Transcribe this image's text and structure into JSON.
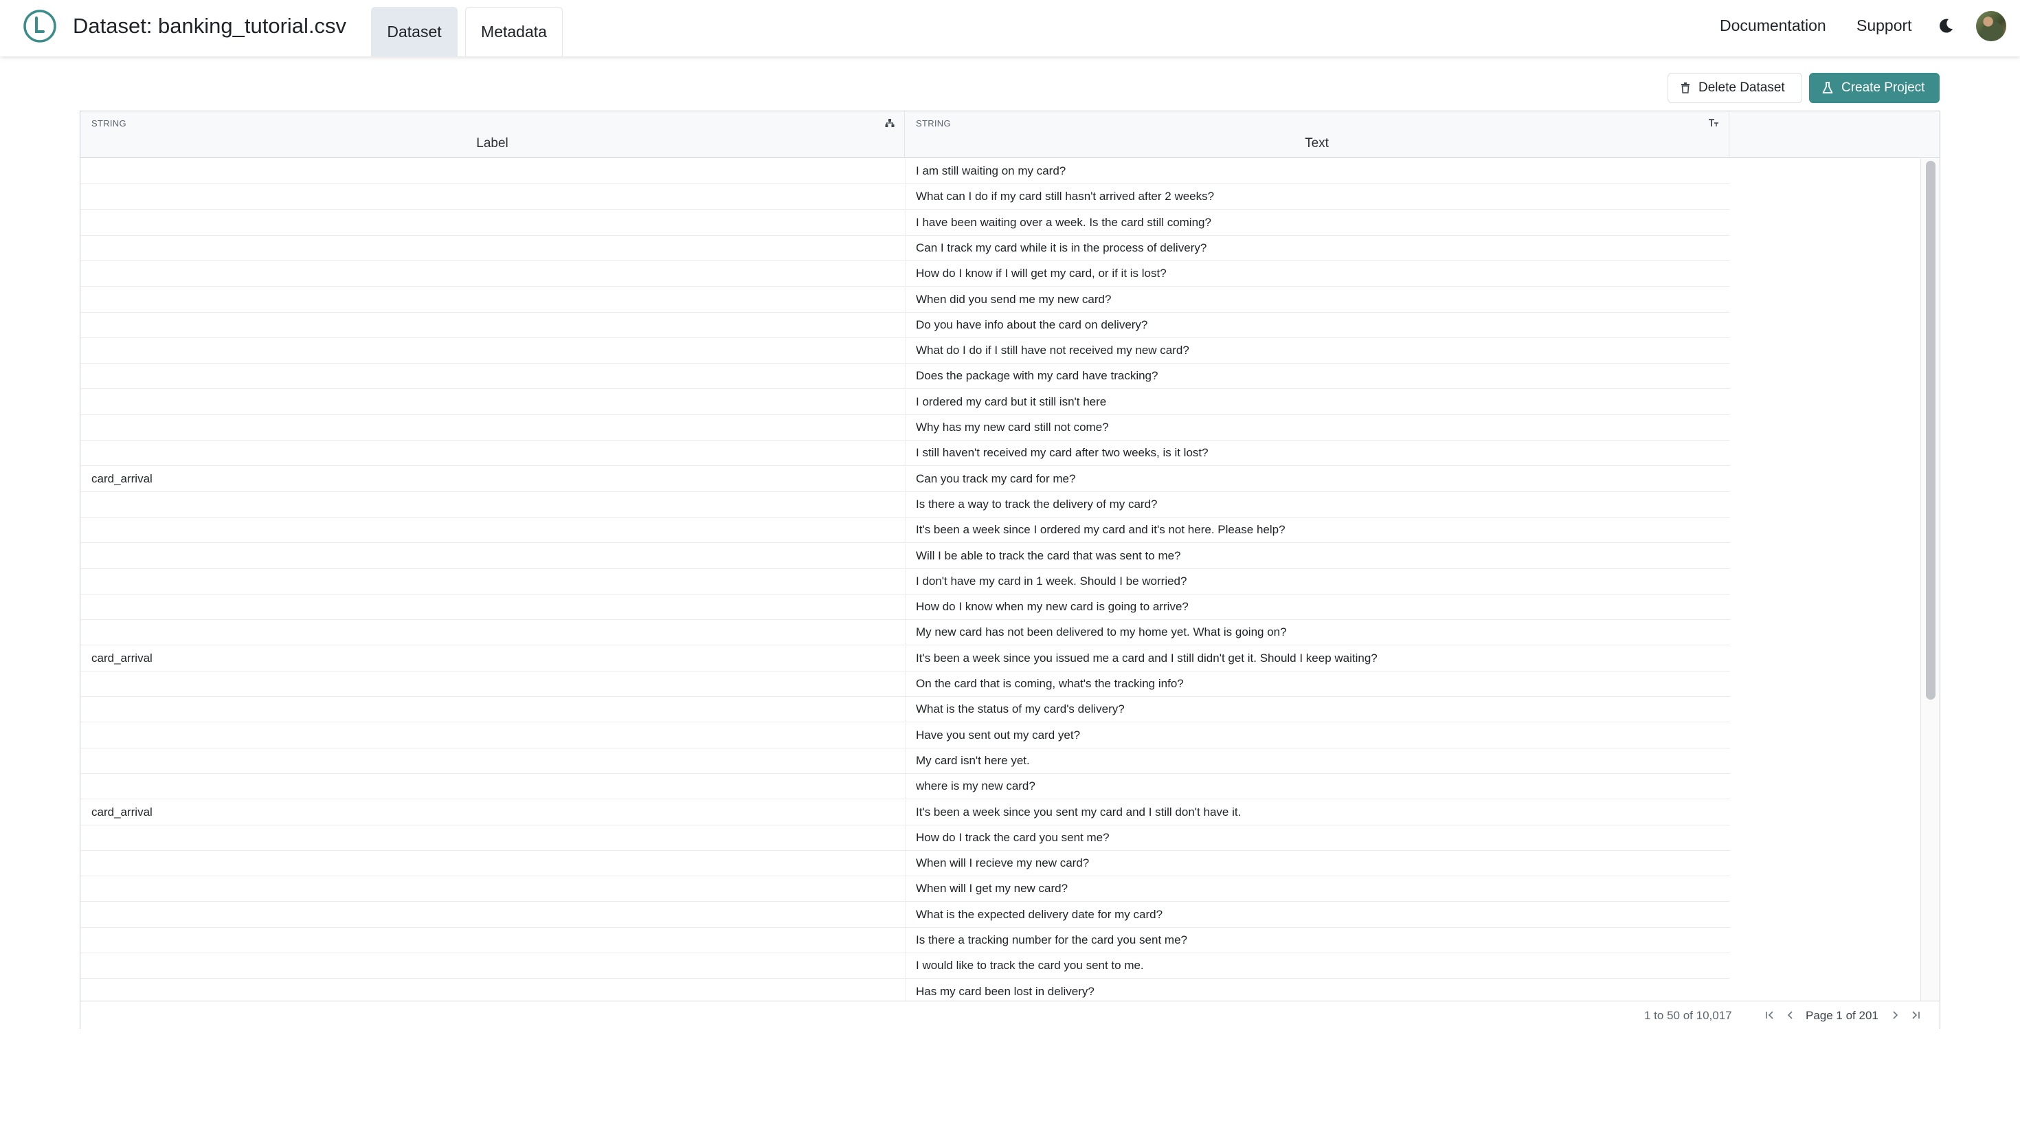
{
  "header": {
    "title": "Dataset: banking_tutorial.csv",
    "tabs": [
      {
        "label": "Dataset",
        "active": true
      },
      {
        "label": "Metadata",
        "active": false
      }
    ],
    "nav": {
      "documentation": "Documentation",
      "support": "Support"
    },
    "icons": {
      "logo": "cleanlab-logo",
      "theme": "moon-icon",
      "avatar": "user-avatar"
    }
  },
  "actions": {
    "delete_label": "Delete Dataset",
    "create_label": "Create Project",
    "accent_color": "#3b8c8b"
  },
  "grid": {
    "columns": [
      {
        "type": "STRING",
        "name": "Label",
        "icon": "hierarchy-icon"
      },
      {
        "type": "STRING",
        "name": "Text",
        "icon": "text-type-icon"
      }
    ],
    "rows": [
      {
        "label": "",
        "text": "I am still waiting on my card?"
      },
      {
        "label": "",
        "text": "What can I do if my card still hasn't arrived after 2 weeks?"
      },
      {
        "label": "",
        "text": "I have been waiting over a week. Is the card still coming?"
      },
      {
        "label": "",
        "text": "Can I track my card while it is in the process of delivery?"
      },
      {
        "label": "",
        "text": "How do I know if I will get my card, or if it is lost?"
      },
      {
        "label": "",
        "text": "When did you send me my new card?"
      },
      {
        "label": "",
        "text": "Do you have info about the card on delivery?"
      },
      {
        "label": "",
        "text": "What do I do if I still have not received my new card?"
      },
      {
        "label": "",
        "text": "Does the package with my card have tracking?"
      },
      {
        "label": "",
        "text": "I ordered my card but it still isn't here"
      },
      {
        "label": "",
        "text": "Why has my new card still not come?"
      },
      {
        "label": "",
        "text": "I still haven't received my card after two weeks, is it lost?"
      },
      {
        "label": "card_arrival",
        "text": "Can you track my card for me?"
      },
      {
        "label": "",
        "text": "Is there a way to track the delivery of my card?"
      },
      {
        "label": "",
        "text": "It's been a week since I ordered my card and it's not here. Please help?"
      },
      {
        "label": "",
        "text": "Will I be able to track the card that was sent to me?"
      },
      {
        "label": "",
        "text": "I don't have my card in 1 week. Should I be worried?"
      },
      {
        "label": "",
        "text": "How do I know when my new card is going to arrive?"
      },
      {
        "label": "",
        "text": "My new card has not been delivered to my home yet. What is going on?"
      },
      {
        "label": "card_arrival",
        "text": "It's been a week since you issued me a card and I still didn't get it. Should I keep waiting?"
      },
      {
        "label": "",
        "text": "On the card that is coming, what's the tracking info?"
      },
      {
        "label": "",
        "text": "What is the status of my card's delivery?"
      },
      {
        "label": "",
        "text": "Have you sent out my card yet?"
      },
      {
        "label": "",
        "text": "My card isn't here yet."
      },
      {
        "label": "",
        "text": "where is my new card?"
      },
      {
        "label": "card_arrival",
        "text": "It's been a week since you sent my card and I still don't have it."
      },
      {
        "label": "",
        "text": "How do I track the card you sent me?"
      },
      {
        "label": "",
        "text": "When will I recieve my new card?"
      },
      {
        "label": "",
        "text": "When will I get my new card?"
      },
      {
        "label": "",
        "text": "What is the expected delivery date for my card?"
      },
      {
        "label": "",
        "text": "Is there a tracking number for the card you sent me?"
      },
      {
        "label": "",
        "text": "I would like to track the card you sent to me."
      },
      {
        "label": "",
        "text": "Has my card been lost in delivery?"
      }
    ],
    "footer": {
      "count": "1 to 50 of 10,017",
      "page": "Page 1 of 201"
    }
  }
}
